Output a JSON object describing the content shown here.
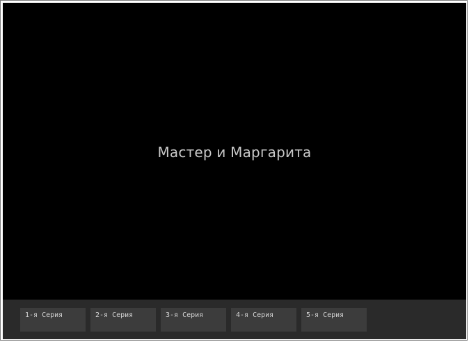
{
  "player": {
    "title": "Мастер и Маргарита"
  },
  "episodes": [
    {
      "label": "1-я Серия"
    },
    {
      "label": "2-я Серия"
    },
    {
      "label": "3-я Серия"
    },
    {
      "label": "4-я Серия"
    },
    {
      "label": "5-я Серия"
    }
  ],
  "colors": {
    "player_background": "#000000",
    "bar_background": "#2a2a2a",
    "button_background": "#3c3c3c",
    "title_text": "#c8c8c8"
  }
}
